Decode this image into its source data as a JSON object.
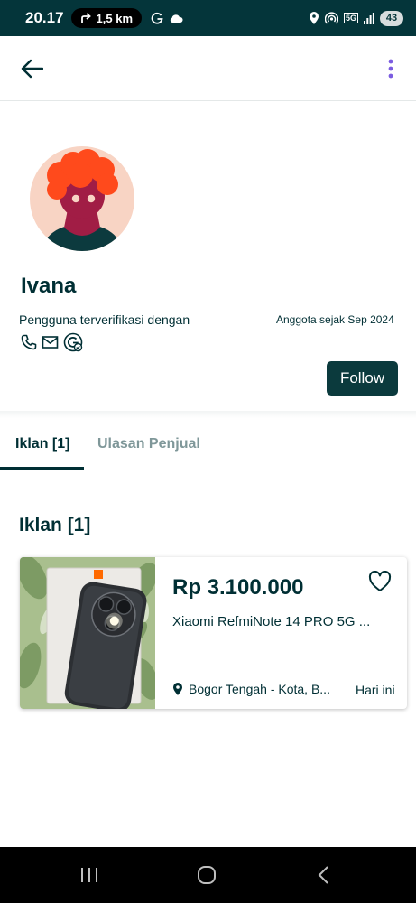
{
  "status_bar": {
    "time": "20.17",
    "distance": "1,5 km",
    "network_badge": "5G",
    "battery": "43",
    "icons": [
      "navigation-arrow-icon",
      "g-icon",
      "cloud-icon",
      "location-pin-icon",
      "hotspot-icon",
      "signal-icon",
      "battery-icon"
    ]
  },
  "header": {
    "back_icon": "arrow-left-icon",
    "menu_icon": "kebab-menu-icon"
  },
  "profile": {
    "name": "Ivana",
    "verified_label": "Pengguna terverifikasi dengan",
    "member_since": "Anggota sejak Sep 2024",
    "verify_icons": [
      "phone-icon",
      "mail-icon",
      "google-icon"
    ],
    "follow_label": "Follow"
  },
  "tabs": [
    {
      "label": "Iklan [1]",
      "active": true
    },
    {
      "label": "Ulasan Penjual",
      "active": false
    }
  ],
  "section_title": "Iklan [1]",
  "listings": [
    {
      "price": "Rp 3.100.000",
      "title": "Xiaomi RefmiNote 14 PRO 5G ...",
      "location": "Bogor Tengah - Kota, B...",
      "date": "Hari ini"
    }
  ],
  "colors": {
    "primary": "#002f34",
    "button": "#0b3a3d",
    "inactive_tab": "#7f9799",
    "status_bar": "#04353a",
    "avatar_bg": "#f8d4c4",
    "avatar_hair": "#ff4a1c",
    "avatar_face": "#a11d45",
    "avatar_body": "#0c3a3e"
  }
}
